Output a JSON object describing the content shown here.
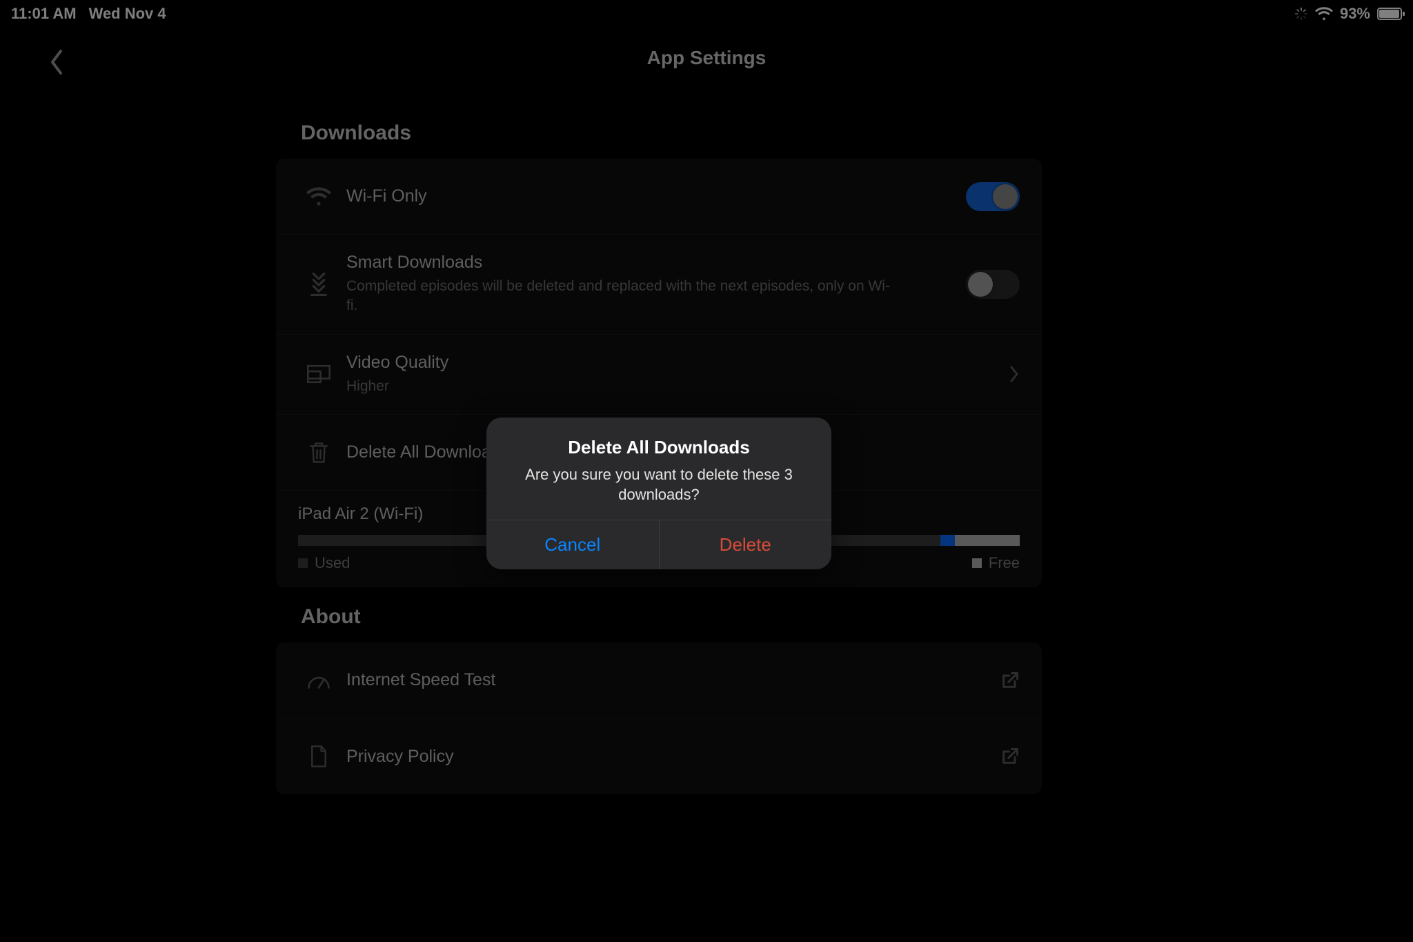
{
  "status": {
    "time": "11:01 AM",
    "date": "Wed Nov 4",
    "battery_pct": "93%"
  },
  "nav": {
    "title": "App Settings"
  },
  "sections": {
    "downloads": {
      "label": "Downloads",
      "wifi_only": {
        "label": "Wi-Fi Only",
        "on": true
      },
      "smart": {
        "label": "Smart Downloads",
        "desc": "Completed episodes will be deleted and replaced with the next episodes, only on Wi-fi.",
        "on": false
      },
      "video_quality": {
        "label": "Video Quality",
        "value": "Higher"
      },
      "delete_all": {
        "label": "Delete All Downloads"
      },
      "storage": {
        "device": "iPad Air 2 (Wi-Fi)",
        "used_pct": 89,
        "netflix_pct": 2,
        "free_pct": 9,
        "legend_used": "Used",
        "legend_free": "Free"
      }
    },
    "about": {
      "label": "About",
      "speed_test": "Internet Speed Test",
      "privacy": "Privacy Policy"
    }
  },
  "alert": {
    "title": "Delete All Downloads",
    "message": "Are you sure you want to delete these 3 downloads?",
    "cancel": "Cancel",
    "delete": "Delete"
  }
}
